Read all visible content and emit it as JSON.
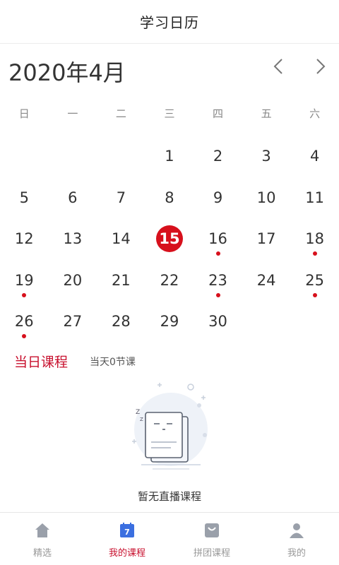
{
  "header": {
    "title": "学习日历"
  },
  "calendar": {
    "month_title": "2020年4月",
    "weekdays": [
      "日",
      "一",
      "二",
      "三",
      "四",
      "五",
      "六"
    ],
    "leading_blanks": 3,
    "days": [
      {
        "n": "1",
        "dot": false
      },
      {
        "n": "2",
        "dot": false
      },
      {
        "n": "3",
        "dot": false
      },
      {
        "n": "4",
        "dot": false
      },
      {
        "n": "5",
        "dot": false
      },
      {
        "n": "6",
        "dot": false
      },
      {
        "n": "7",
        "dot": false
      },
      {
        "n": "8",
        "dot": false
      },
      {
        "n": "9",
        "dot": false
      },
      {
        "n": "10",
        "dot": false
      },
      {
        "n": "11",
        "dot": false
      },
      {
        "n": "12",
        "dot": false
      },
      {
        "n": "13",
        "dot": false
      },
      {
        "n": "14",
        "dot": false
      },
      {
        "n": "15",
        "dot": false,
        "today": true
      },
      {
        "n": "16",
        "dot": true
      },
      {
        "n": "17",
        "dot": false
      },
      {
        "n": "18",
        "dot": true
      },
      {
        "n": "19",
        "dot": true
      },
      {
        "n": "20",
        "dot": false
      },
      {
        "n": "21",
        "dot": false
      },
      {
        "n": "22",
        "dot": false
      },
      {
        "n": "23",
        "dot": true
      },
      {
        "n": "24",
        "dot": false
      },
      {
        "n": "25",
        "dot": true
      },
      {
        "n": "26",
        "dot": true
      },
      {
        "n": "27",
        "dot": false
      },
      {
        "n": "28",
        "dot": false
      },
      {
        "n": "29",
        "dot": false
      },
      {
        "n": "30",
        "dot": false
      }
    ]
  },
  "section": {
    "title": "当日课程",
    "subtitle": "当天0节课"
  },
  "empty_state": {
    "text": "暂无直播课程",
    "icon": "empty-sleep-icon"
  },
  "tabbar": {
    "items": [
      {
        "label": "精选",
        "icon": "home-icon",
        "active": false
      },
      {
        "label": "我的课程",
        "icon": "calendar-icon",
        "active": true,
        "badge": "7"
      },
      {
        "label": "拼团课程",
        "icon": "bag-icon",
        "active": false
      },
      {
        "label": "我的",
        "icon": "user-icon",
        "active": false
      }
    ]
  },
  "colors": {
    "accent": "#c8102e",
    "today": "#d7101c",
    "icon_gray": "#9aa0aa",
    "icon_blue": "#3b6fe0"
  }
}
